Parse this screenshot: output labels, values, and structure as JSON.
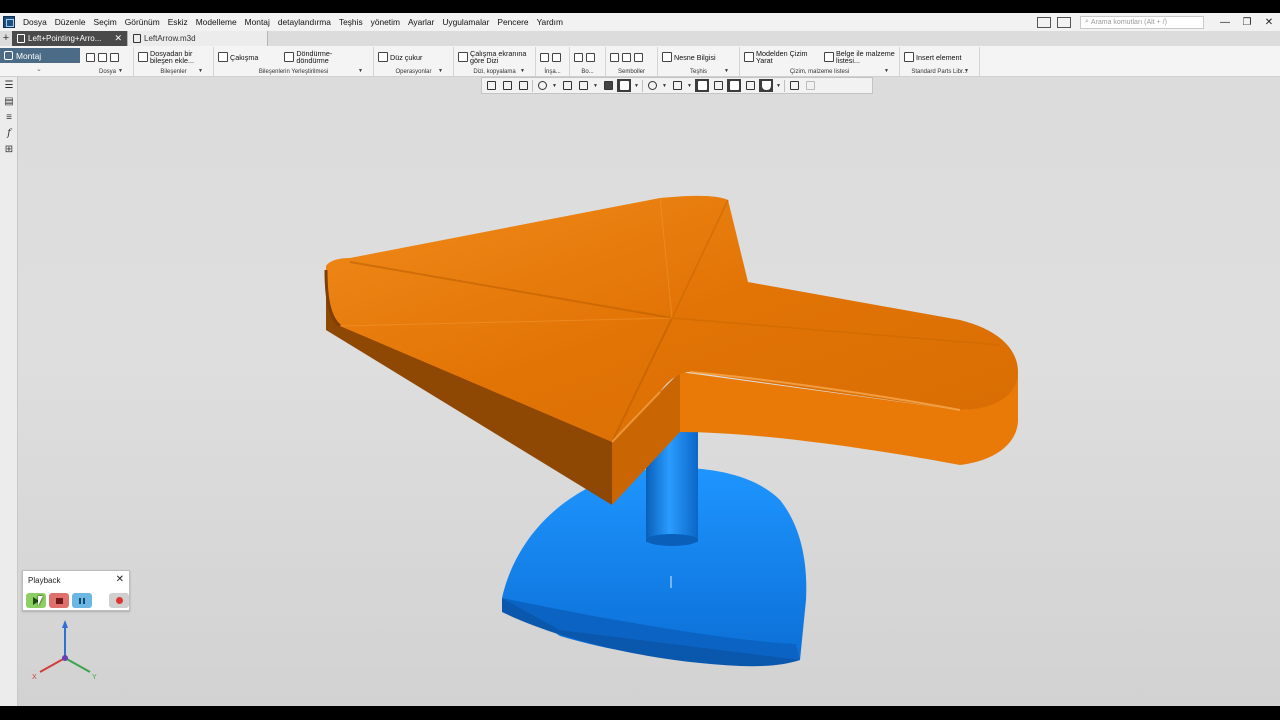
{
  "menu": {
    "items": [
      "Dosya",
      "Düzenle",
      "Seçim",
      "Görünüm",
      "Eskiz",
      "Modelleme",
      "Montaj",
      "detaylandırma",
      "Teşhis",
      "yönetim",
      "Ayarlar",
      "Uygulamalar",
      "Pencere",
      "Yardım"
    ],
    "search_placeholder": "Arama komutları (Alt + /)"
  },
  "tabs": [
    {
      "label": "Left+Pointing+Arro...",
      "active": true
    },
    {
      "label": "LeftArrow.m3d",
      "active": false
    }
  ],
  "ribbon": {
    "mode": "Montaj",
    "groups": [
      {
        "label": "Dosya"
      },
      {
        "button": "Dosyadan bir bileşen ekle...",
        "label": "Bileşenler"
      },
      {
        "button1": "Çakışma",
        "button2": "Döndürme-döndürme",
        "label": "Bileşenlerin Yerleştirilmesi"
      },
      {
        "button": "Düz çukur",
        "label": "Operasyonlar"
      },
      {
        "button": "Çalışma ekranına göre Dizi",
        "label": "Dizi, kopyalama"
      },
      {
        "label": "İnşa..."
      },
      {
        "label": "Bo..."
      },
      {
        "label": "Semboller"
      },
      {
        "button": "Nesne Bilgisi",
        "label": "Teşhis"
      },
      {
        "button1": "Modelden Çizim Yarat",
        "button2": "Belge ile malzeme listesi...",
        "label": "Çizim, malzeme listesi"
      },
      {
        "button": "Insert element",
        "label": "Standard Parts Libr..."
      }
    ]
  },
  "playback": {
    "title": "Playback",
    "controls": [
      "play-icon",
      "stop-icon",
      "pause-icon",
      "record-icon"
    ]
  },
  "triad": {
    "x": "X",
    "y": "Y"
  },
  "colors": {
    "arrow_orange": "#E57708",
    "base_blue": "#0A7FF0",
    "mode_tab": "#4B6B86",
    "active_tab": "#4A4A4A"
  }
}
